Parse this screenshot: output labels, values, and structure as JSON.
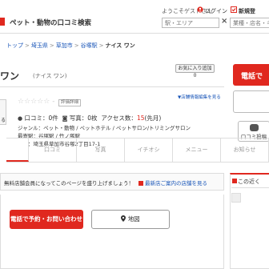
{
  "header": {
    "site_title": "ペット・動物の口コミ検索",
    "welcome": "ようこそゲストさん",
    "login": "ログイン",
    "register": "新規登",
    "station_placeholder": "駅・エリア",
    "clear": "×",
    "keyword_placeholder": "業種・店名・キーワ"
  },
  "breadcrumb": {
    "items": [
      "トップ",
      "埼玉県",
      "草加市",
      "谷塚駅"
    ],
    "current": "ナイス ワン",
    "separator": ">"
  },
  "shop": {
    "name": "ワン",
    "kana": "(ナイス ワン)",
    "favorite_button": "お気に入り追加",
    "favorite_count": "0",
    "phone_button": "電話で",
    "thumb_label": "る",
    "stars": "☆☆☆☆☆",
    "rating": "-",
    "eval_detail": "評価詳細",
    "manage_link": "店舗情報編集を見る",
    "reviews_label": "口コミ：",
    "reviews_value": "0件",
    "photos_label": "写真：",
    "photos_value": "0枚",
    "access_label": "アクセス数：",
    "access_value": "15",
    "access_suffix": "(先月)",
    "genre": "ジャンル：ペット・動物 / ペットホテル / ペットサロン/トリミングサロン",
    "station": "最寄駅：谷塚駅 / 竹ノ塚駅",
    "address": "住所：埼玉県草加市谷塚2丁目17-1",
    "review_post_button": "口コミ投稿"
  },
  "tabs": [
    "",
    "口コミ",
    "写真",
    "イチオシ",
    "メニュー",
    "お知らせ"
  ],
  "notice": {
    "text": "無料店舗会員になってこのページを盛り上げましょう！",
    "link": "最新店ご案内の店舗を見る"
  },
  "actions": {
    "reserve": "電話で予約・お問い合わせ",
    "map": "地図"
  },
  "sidebar": {
    "near_title": "この近く"
  },
  "colors": {
    "accent": "#e0281f",
    "link": "#1a56b8"
  }
}
